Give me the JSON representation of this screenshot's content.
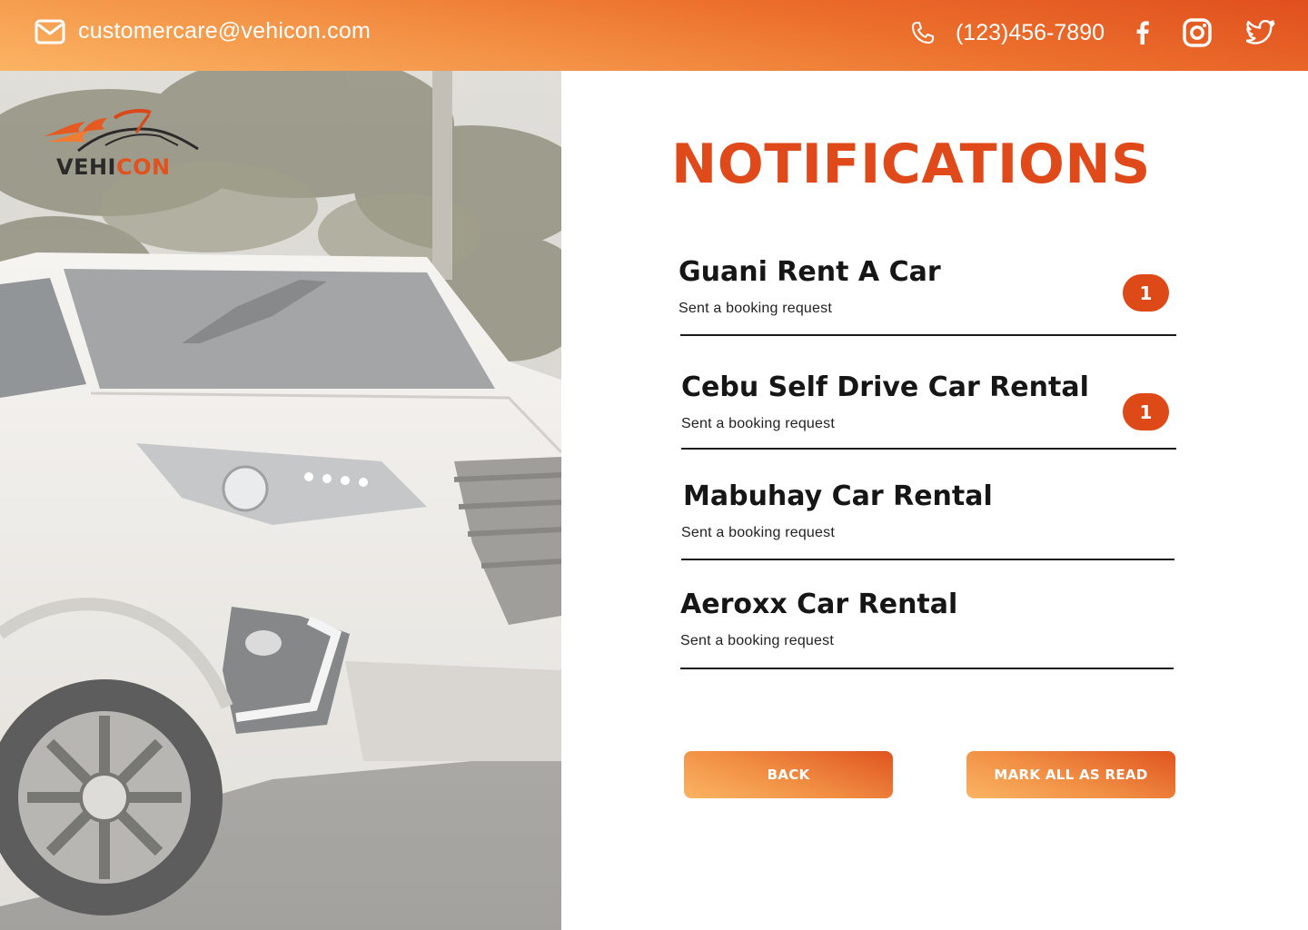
{
  "contact": {
    "email": "customercare@vehicon.com",
    "phone": "(123)456-7890"
  },
  "social": [
    "facebook-icon",
    "instagram-icon",
    "twitter-icon"
  ],
  "brand": {
    "logo_part1": "VEHI",
    "logo_part2": "CON",
    "accent_color": "#e04a1a"
  },
  "page": {
    "title": "NOTIFICATIONS"
  },
  "notifications": [
    {
      "name": "Guani Rent A Car",
      "message": "Sent a booking request",
      "unread": "1"
    },
    {
      "name": "Cebu Self Drive Car Rental",
      "message": "Sent a booking request",
      "unread": "1"
    },
    {
      "name": "Mabuhay Car Rental",
      "message": "Sent a booking request",
      "unread": ""
    },
    {
      "name": "Aeroxx Car Rental",
      "message": "Sent a booking request",
      "unread": ""
    }
  ],
  "actions": {
    "back_label": "BACK",
    "mark_all_label": "MARK ALL AS READ"
  }
}
